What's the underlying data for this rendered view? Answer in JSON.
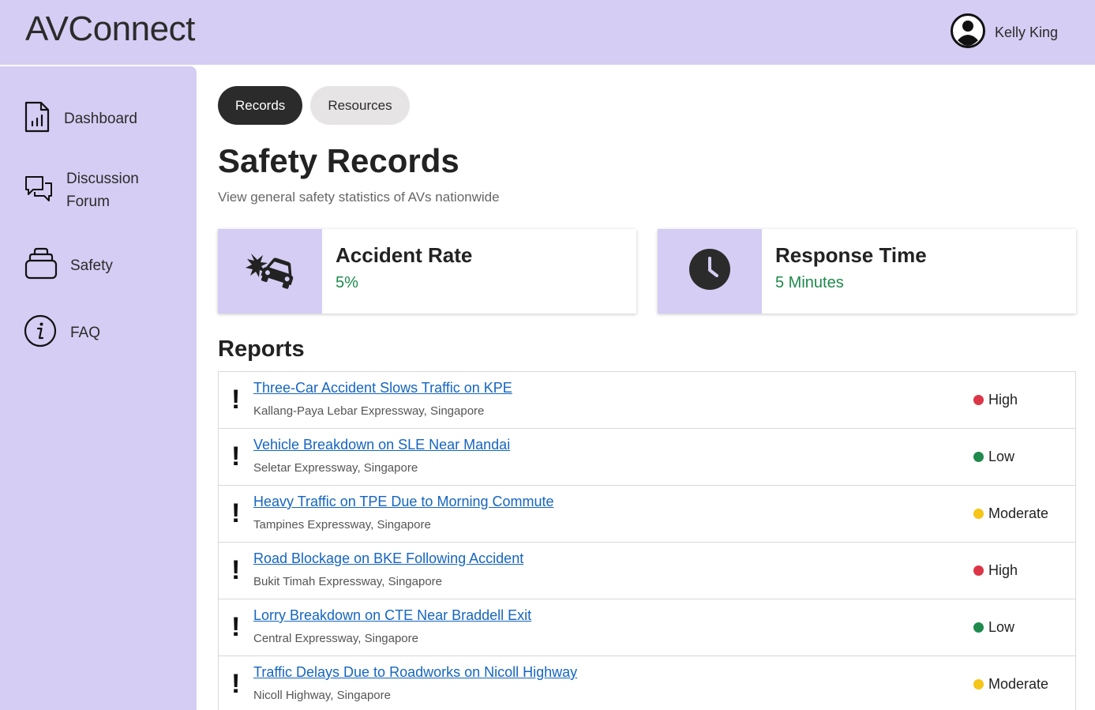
{
  "app": {
    "title": "AVConnect"
  },
  "user": {
    "name": "Kelly King"
  },
  "sidebar": {
    "items": [
      {
        "label": "Dashboard",
        "icon": "dashboard-icon"
      },
      {
        "label_line1": "Discussion",
        "label_line2": "Forum",
        "icon": "chat-icon"
      },
      {
        "label": "Safety",
        "icon": "safety-icon"
      },
      {
        "label": "FAQ",
        "icon": "info-icon"
      }
    ]
  },
  "tabs": [
    {
      "label": "Records",
      "active": true
    },
    {
      "label": "Resources",
      "active": false
    }
  ],
  "page": {
    "title": "Safety Records",
    "subtitle": "View general safety statistics of AVs nationwide"
  },
  "stats": [
    {
      "title": "Accident Rate",
      "value": "5%",
      "icon": "car-crash-icon"
    },
    {
      "title": "Response Time",
      "value": "5 Minutes",
      "icon": "clock-icon"
    }
  ],
  "reports": {
    "title": "Reports",
    "items": [
      {
        "title": "Three-Car Accident Slows Traffic on KPE",
        "location": "Kallang-Paya Lebar Expressway, Singapore",
        "severity": "High"
      },
      {
        "title": "Vehicle Breakdown on SLE Near Mandai",
        "location": "Seletar Expressway, Singapore",
        "severity": "Low"
      },
      {
        "title": "Heavy Traffic on TPE Due to Morning Commute",
        "location": "Tampines Expressway, Singapore",
        "severity": "Moderate"
      },
      {
        "title": "Road Blockage on BKE Following Accident",
        "location": "Bukit Timah Expressway, Singapore",
        "severity": "High"
      },
      {
        "title": "Lorry Breakdown on CTE Near Braddell Exit",
        "location": "Central Expressway, Singapore",
        "severity": "Low"
      },
      {
        "title": "Traffic Delays Due to Roadworks on Nicoll Highway",
        "location": "Nicoll Highway, Singapore",
        "severity": "Moderate"
      }
    ]
  },
  "colors": {
    "accent": "#d5cdf3",
    "high": "#dc3545",
    "low": "#1e8a4c",
    "moderate": "#f5c518"
  }
}
